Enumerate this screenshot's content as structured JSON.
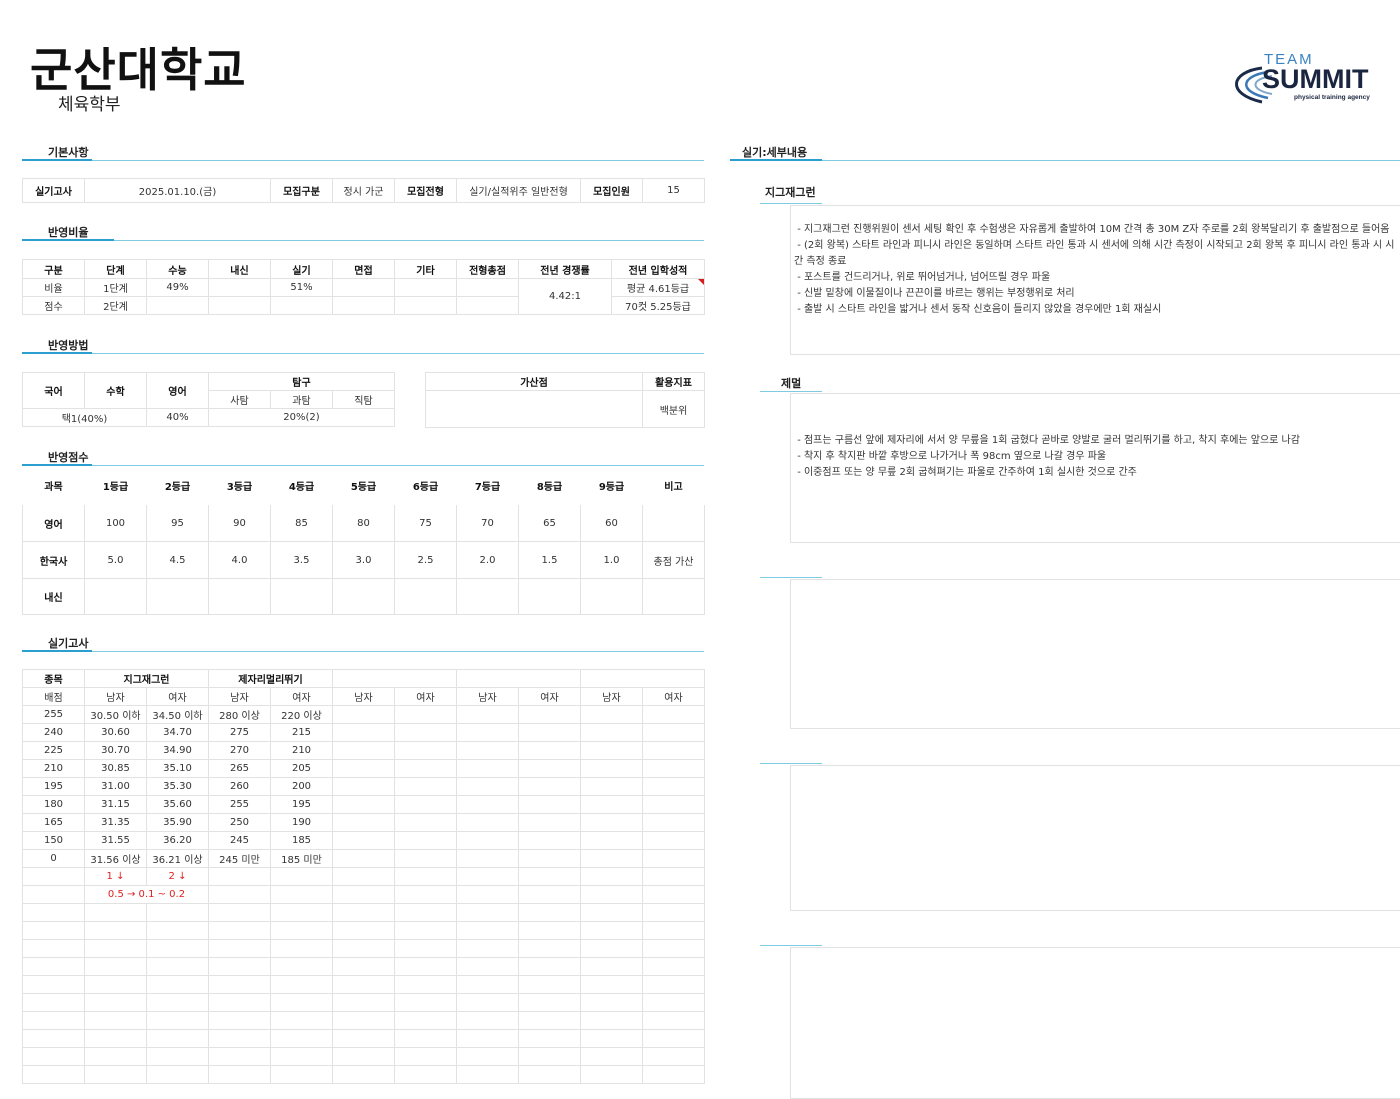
{
  "header": {
    "university": "군산대학교",
    "department": "체육학부"
  },
  "logo": {
    "line1": "TEAM",
    "line2": "SUMMIT",
    "line3": "physical training agency"
  },
  "sections": {
    "basic": "기본사항",
    "ratio": "반영비율",
    "method": "반영방법",
    "score": "반영점수",
    "practical": "실기고사",
    "detail": "실기:세부내용"
  },
  "basic": {
    "exam_label": "실기고사",
    "exam_date": "2025.01.10.(금)",
    "type_label": "모집구분",
    "type_value": "정시 가군",
    "track_label": "모집전형",
    "track_value": "실기/실적위주 일반전형",
    "quota_label": "모집인원",
    "quota_value": "15"
  },
  "ratio": {
    "headers": [
      "구분",
      "단계",
      "수능",
      "내신",
      "실기",
      "면접",
      "기타",
      "전형총점",
      "전년 경쟁률",
      "전년 입학성적"
    ],
    "row1": [
      "비율",
      "1단계",
      "49%",
      "",
      "51%",
      "",
      "",
      ""
    ],
    "row2": [
      "점수",
      "2단계",
      "",
      "",
      "",
      "",
      "",
      ""
    ],
    "competition": "4.42:1",
    "admission1": "평균 4.61등급",
    "admission2": "70컷 5.25등급"
  },
  "method": {
    "kor": "국어",
    "math": "수학",
    "eng": "영어",
    "inquiry": "탐구",
    "social": "사탐",
    "science": "과탐",
    "career": "직탐",
    "row_kormath": "택1(40%)",
    "row_eng": "40%",
    "row_inq": "20%(2)",
    "bonus": "가산점",
    "index": "활용지표",
    "index_value": "백분위"
  },
  "score": {
    "headers": [
      "과목",
      "1등급",
      "2등급",
      "3등급",
      "4등급",
      "5등급",
      "6등급",
      "7등급",
      "8등급",
      "9등급",
      "비고"
    ],
    "rows": [
      [
        "영어",
        "100",
        "95",
        "90",
        "85",
        "80",
        "75",
        "70",
        "65",
        "60",
        ""
      ],
      [
        "한국사",
        "5.0",
        "4.5",
        "4.0",
        "3.5",
        "3.0",
        "2.5",
        "2.0",
        "1.5",
        "1.0",
        "총점 가산"
      ],
      [
        "내신",
        "",
        "",
        "",
        "",
        "",
        "",
        "",
        "",
        "",
        ""
      ]
    ]
  },
  "practical": {
    "item_label": "종목",
    "score_label": "배점",
    "event1": "지그재그런",
    "event2": "제자리멀리뛰기",
    "male": "남자",
    "female": "여자",
    "rows": [
      [
        "255",
        "30.50 이하",
        "34.50 이하",
        "280 이상",
        "220 이상"
      ],
      [
        "240",
        "30.60",
        "34.70",
        "275",
        "215"
      ],
      [
        "225",
        "30.70",
        "34.90",
        "270",
        "210"
      ],
      [
        "210",
        "30.85",
        "35.10",
        "265",
        "205"
      ],
      [
        "195",
        "31.00",
        "35.30",
        "260",
        "200"
      ],
      [
        "180",
        "31.15",
        "35.60",
        "255",
        "195"
      ],
      [
        "165",
        "31.35",
        "35.90",
        "250",
        "190"
      ],
      [
        "150",
        "31.55",
        "36.20",
        "245",
        "185"
      ],
      [
        "0",
        "31.56 이상",
        "36.21 이상",
        "245 미만",
        "185 미만"
      ]
    ],
    "note_male": "1 ↓",
    "note_female": "2 ↓",
    "note_step": "0.5 → 0.1 ~ 0.2"
  },
  "detail": {
    "zigzag_title": "지그재그런",
    "zigzag_text": " - 지그재그런 진행위원이 센서 세팅 확인 후 수험생은 자유롭게 출발하여 10M 간격 총 30M Z자 주로를 2회 왕복달리기 후 출발점으로 들어옴\n - (2회 왕복) 스타트 라인과 피니시 라인은 동일하며 스타트 라인 통과 시 센서에 의해 시간 측정이 시작되고 2회 왕복 후 피니시 라인 통과 시 시간 측정 종료\n - 포스트를 건드리거나, 위로 뛰어넘거나, 넘어뜨릴 경우 파울\n - 신발 밑창에 이물질이나 끈끈이를 바르는 행위는 부정행위로 처리\n - 출발 시 스타트 라인을 밟거나 센서 동작 신호음이 들리지 않았을 경우에만 1회 재실시",
    "jump_title": "제멀",
    "jump_text": " - 점프는 구름선 앞에 제자리에 서서 양 무릎을 1회 굽혔다 곧바로 양발로 굴러 멀리뛰기를 하고, 착지 후에는 앞으로 나감\n - 착지 후 착지판 바깥 후방으로 나가거나 폭 98cm 옆으로 나갈 경우 파울\n - 이중점프 또는 양 무릎 2회 굽혀펴기는 파울로 간주하여 1회 실시한 것으로 간주"
  }
}
